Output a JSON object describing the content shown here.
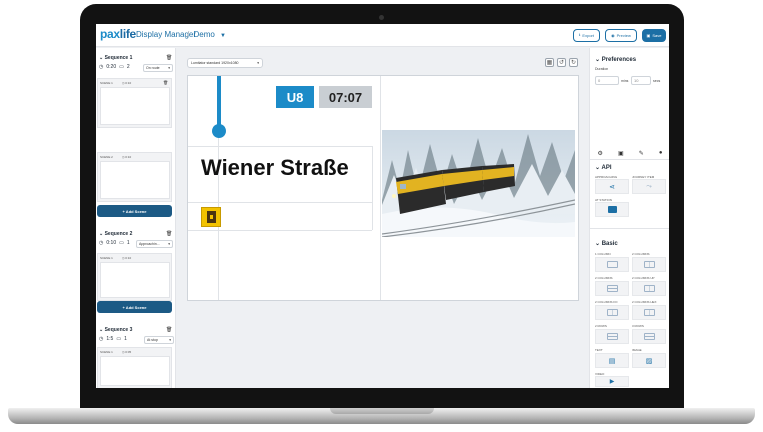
{
  "header": {
    "logo_main": "pax",
    "logo_accent": "life",
    "app_title": "Display Manager",
    "crumb_sep": "/",
    "project": "Demo",
    "export_label": "Export",
    "preview_label": "Preview",
    "save_label": "Save"
  },
  "sequences": [
    {
      "title": "Sequence 1",
      "duration": "0:20",
      "screens": "2",
      "mode": "On route",
      "scenes": [
        {
          "label": "SCENE 1",
          "time": "0:10"
        },
        {
          "label": "SCENE 2",
          "time": "0:10"
        }
      ]
    },
    {
      "title": "Sequence 2",
      "duration": "0:10",
      "screens": "1",
      "mode": "Approachin...",
      "scenes": [
        {
          "label": "SCENE 1",
          "time": "0:10"
        }
      ]
    },
    {
      "title": "Sequence 3",
      "duration": "1:5",
      "screens": "1",
      "mode": "At stop",
      "scenes": [
        {
          "label": "SCENE 1",
          "time": "0:05"
        }
      ]
    }
  ],
  "add_scene_label": "+ Add Scene",
  "main": {
    "screen_option": "Lumitator standard 1920x1080",
    "line": "U8",
    "time": "07:07",
    "station": "Wiener Straße"
  },
  "preferences": {
    "title": "Preferences",
    "duration_label": "Duration",
    "min_value": "0",
    "min_unit": "mins",
    "sec_value": "10",
    "sec_unit": "secs"
  },
  "api": {
    "title": "API",
    "items": [
      {
        "label": "APPROACHING"
      },
      {
        "label": "JOURNEY ITEM"
      },
      {
        "label": "AT STATION"
      }
    ]
  },
  "basic": {
    "title": "Basic",
    "items": [
      {
        "label": "1 COLUMN"
      },
      {
        "label": "2 COLUMNS"
      },
      {
        "label": "2 COLUMNS"
      },
      {
        "label": "2 COLUMNS UP"
      },
      {
        "label": "2 COLUMNS FO"
      },
      {
        "label": "2 COLUMNS HEX"
      },
      {
        "label": "2 ROWS"
      },
      {
        "label": "3 ROWS"
      },
      {
        "label": "TEXT"
      },
      {
        "label": "IMAGE"
      },
      {
        "label": "VIDEO"
      }
    ]
  },
  "colors": {
    "accent": "#1c8bc8",
    "navy": "#1c5a85",
    "time_bg": "#c9ced3",
    "exit_yellow": "#f2c200"
  }
}
